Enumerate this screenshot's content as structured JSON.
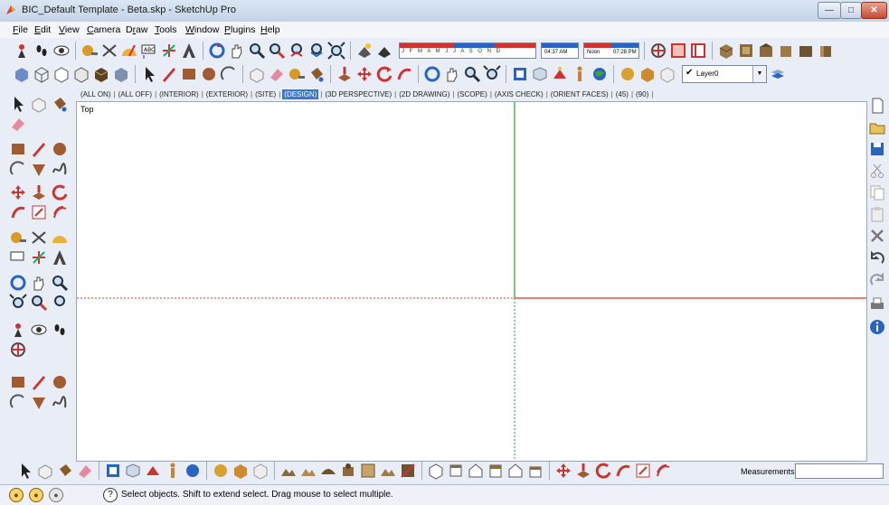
{
  "window": {
    "title": "BIC_Default Template - Beta.skp - SketchUp Pro"
  },
  "titlebar_buttons": {
    "minimize": "—",
    "maximize": "□",
    "close": "✕"
  },
  "menu": [
    {
      "label": "File",
      "u": "F",
      "rest": "ile"
    },
    {
      "label": "Edit",
      "u": "E",
      "rest": "dit"
    },
    {
      "label": "View",
      "u": "V",
      "rest": "iew"
    },
    {
      "label": "Camera",
      "u": "C",
      "rest": "amera"
    },
    {
      "label": "Draw",
      "u": "r",
      "pre": "D",
      "rest": "aw"
    },
    {
      "label": "Tools",
      "u": "T",
      "rest": "ools"
    },
    {
      "label": "Window",
      "u": "W",
      "rest": "indow"
    },
    {
      "label": "Plugins",
      "u": "P",
      "rest": "lugins"
    },
    {
      "label": "Help",
      "u": "H",
      "rest": "elp"
    }
  ],
  "shadow": {
    "months": "J F M A M J J A S O N D",
    "sunrise_label": "04:37 AM",
    "noon_label": "Noon",
    "sunset_label": "07:28 PM"
  },
  "layer": {
    "checked": "✔",
    "name": "Layer0"
  },
  "scenes": [
    {
      "label": "(ALL ON)",
      "active": false
    },
    {
      "label": "(ALL OFF)",
      "active": false
    },
    {
      "label": "(INTERIOR)",
      "active": false
    },
    {
      "label": "(EXTERIOR)",
      "active": false
    },
    {
      "label": "(SITE)",
      "active": false
    },
    {
      "label": "(DESIGN)",
      "active": true
    },
    {
      "label": "(3D PERSPECTIVE)",
      "active": false
    },
    {
      "label": "(2D DRAWING)",
      "active": false
    },
    {
      "label": "(SCOPE)",
      "active": false
    },
    {
      "label": "(AXIS CHECK)",
      "active": false
    },
    {
      "label": "(ORIENT FACES)",
      "active": false
    },
    {
      "label": "(45)",
      "active": false
    },
    {
      "label": "(90)",
      "active": false
    }
  ],
  "viewport": {
    "view_name": "Top"
  },
  "measurements": {
    "label": "Measurements",
    "value": ""
  },
  "status": {
    "help_icon": "?",
    "message": "Select objects. Shift to extend select. Drag mouse to select multiple."
  },
  "colors": {
    "red_axis": "#e0332b",
    "green_axis": "#27a338",
    "scene_active": "#3c78c9"
  }
}
